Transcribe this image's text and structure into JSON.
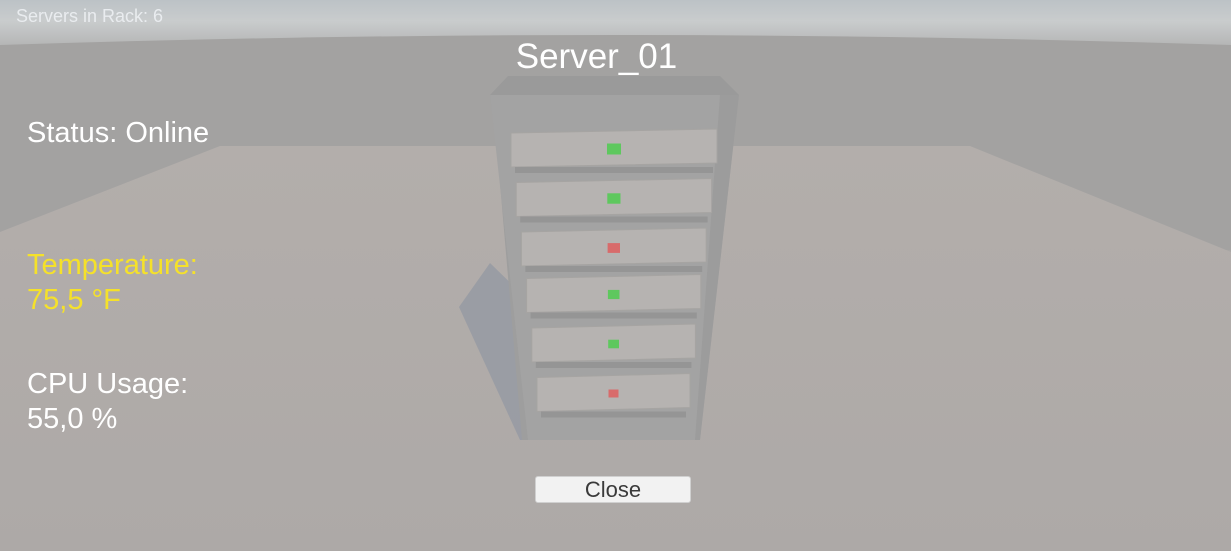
{
  "hud": {
    "rack_count_text": "Servers in Rack: 6"
  },
  "panel": {
    "title": "Server_01",
    "status_text": "Status: Online",
    "temperature_label": "Temperature:",
    "temperature_value": "75,5 °F",
    "cpu_label": "CPU Usage:",
    "cpu_value": "55,0 %",
    "close_label": "Close"
  },
  "colors": {
    "text": "#ffffff",
    "temperature_text": "#f5e12a",
    "led_online": "#5ec85e",
    "led_offline": "#d86b6b"
  },
  "rack": {
    "units": [
      {
        "status": "online"
      },
      {
        "status": "online"
      },
      {
        "status": "offline"
      },
      {
        "status": "online"
      },
      {
        "status": "online"
      },
      {
        "status": "offline"
      }
    ]
  }
}
